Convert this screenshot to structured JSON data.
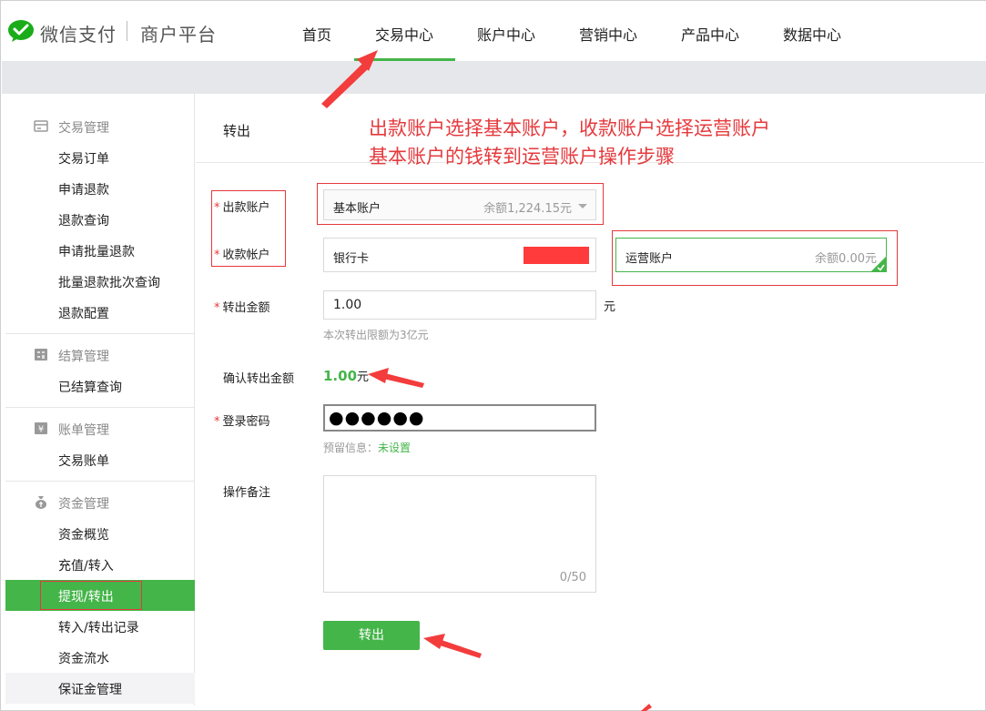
{
  "header": {
    "brand": "微信支付",
    "brand_sub": "商户平台",
    "nav": [
      "首页",
      "交易中心",
      "账户中心",
      "营销中心",
      "产品中心",
      "数据中心"
    ],
    "active_nav": "交易中心"
  },
  "sidebar": {
    "sections": [
      {
        "title": "交易管理",
        "items": [
          "交易订单",
          "申请退款",
          "退款查询",
          "申请批量退款",
          "批量退款批次查询",
          "退款配置"
        ]
      },
      {
        "title": "结算管理",
        "items": [
          "已结算查询"
        ]
      },
      {
        "title": "账单管理",
        "items": [
          "交易账单"
        ]
      },
      {
        "title": "资金管理",
        "items": [
          "资金概览",
          "充值/转入",
          "提现/转出",
          "转入/转出记录",
          "资金流水",
          "保证金管理"
        ]
      }
    ],
    "active_item": "提现/转出",
    "bill_icon_glyph": "¥"
  },
  "main": {
    "title": "转出",
    "annotation": [
      "出款账户选择基本账户，收款账户选择运营账户",
      "基本账户的钱转到运营账户操作步骤"
    ],
    "form": {
      "from_label": "出款账户",
      "from_account": "基本账户",
      "from_balance": "余额1,224.15元",
      "to_label": "收款帐户",
      "to_option_bank": "银行卡",
      "to_option_ops": "运营账户",
      "to_ops_balance": "余额0.00元",
      "amount_label": "转出金额",
      "amount_value": "1.00",
      "amount_unit": "元",
      "amount_hint": "本次转出限额为3亿元",
      "confirm_label": "确认转出金额",
      "confirm_value": "1.00",
      "confirm_unit": "元",
      "password_label": "登录密码",
      "password_dots": "●●●●●●",
      "reserved_label": "预留信息：",
      "reserved_value": "未设置",
      "remark_label": "操作备注",
      "remark_counter": "0/50",
      "submit_label": "转出"
    }
  },
  "colors": {
    "accent_green": "#44b549",
    "annotation_red": "#e5393c",
    "band_gray": "#e6e7ea"
  }
}
